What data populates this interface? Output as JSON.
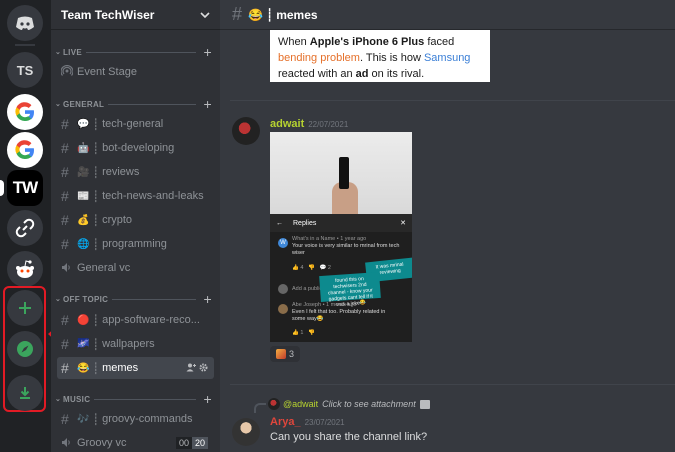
{
  "servers": {
    "home_icon": "discord-logo-icon",
    "ts_label": "TS",
    "tw_label": "TW",
    "add_icon": "plus-icon",
    "explore_icon": "compass-icon",
    "download_icon": "download-icon",
    "highlight_color": "#e21b25"
  },
  "guild": {
    "name": "Team TechWiser",
    "chevron_icon": "chevron-down-icon"
  },
  "categories": {
    "live": "LIVE",
    "general": "GENERAL",
    "off_topic": "OFF TOPIC",
    "music": "MUSIC"
  },
  "channels": {
    "event_stage": "Event Stage",
    "tech_general": {
      "emoji": "💬",
      "name": "tech-general"
    },
    "bot_developing": {
      "emoji": "🤖",
      "name": "bot-developing"
    },
    "reviews": {
      "emoji": "🎥",
      "name": "reviews"
    },
    "tech_news": {
      "emoji": "📰",
      "name": "tech-news-and-leaks"
    },
    "crypto": {
      "emoji": "💰",
      "name": "crypto"
    },
    "programming": {
      "emoji": "🌐",
      "name": "programming"
    },
    "general_vc": "General vc",
    "app_software": {
      "emoji": "🔴",
      "name": "app-software-reco..."
    },
    "wallpapers": {
      "emoji": "🌌",
      "name": "wallpapers"
    },
    "memes": {
      "emoji": "😂",
      "name": "memes"
    },
    "groovy_commands": {
      "emoji": "🎶",
      "name": "groovy-commands"
    },
    "groovy_vc": {
      "name": "Groovy vc",
      "count_in": "00",
      "count_limit": "20"
    }
  },
  "topbar": {
    "emoji": "😂",
    "channel": "memes"
  },
  "quote_card": {
    "p1": "When ",
    "p2": "Apple's iPhone 6 Plus",
    "p3": " faced",
    "p4": "bending problem",
    "p5": ". This is how ",
    "p6": "Samsung",
    "p7": "reacted with an ",
    "p8": "ad",
    "p9": " on its rival."
  },
  "messages": {
    "adwait": {
      "author": "adwait",
      "timestamp": "22/07/2021",
      "author_color": "#b6d230"
    },
    "attachment": {
      "replies_title": "Replies",
      "comment1_meta": "What's in a Name • 1 year ago",
      "comment1_text": "Your voice is very similar to mrinal from tech wiser",
      "comment1_likes": "4",
      "comment1_replies": "2",
      "add_public_reply": "Add a public re...",
      "comment2_meta": "Abe Joseph • 1 month ago",
      "comment2_text": "Even I felt that too. Probably related in some way😂",
      "comment2_likes": "1",
      "sticker_a": "It was mrinal reviewing",
      "sticker_b": "found this on techwisers 2nd channel - know your gadgets cant tell if it was a joke😂"
    },
    "reaction": {
      "count": "3"
    },
    "arya": {
      "reply_name": "@adwait",
      "reply_text": "Click to see attachment",
      "author": "Arya_",
      "timestamp": "23/07/2021",
      "text": "Can you share the channel link?",
      "author_color": "#e0463c"
    }
  }
}
